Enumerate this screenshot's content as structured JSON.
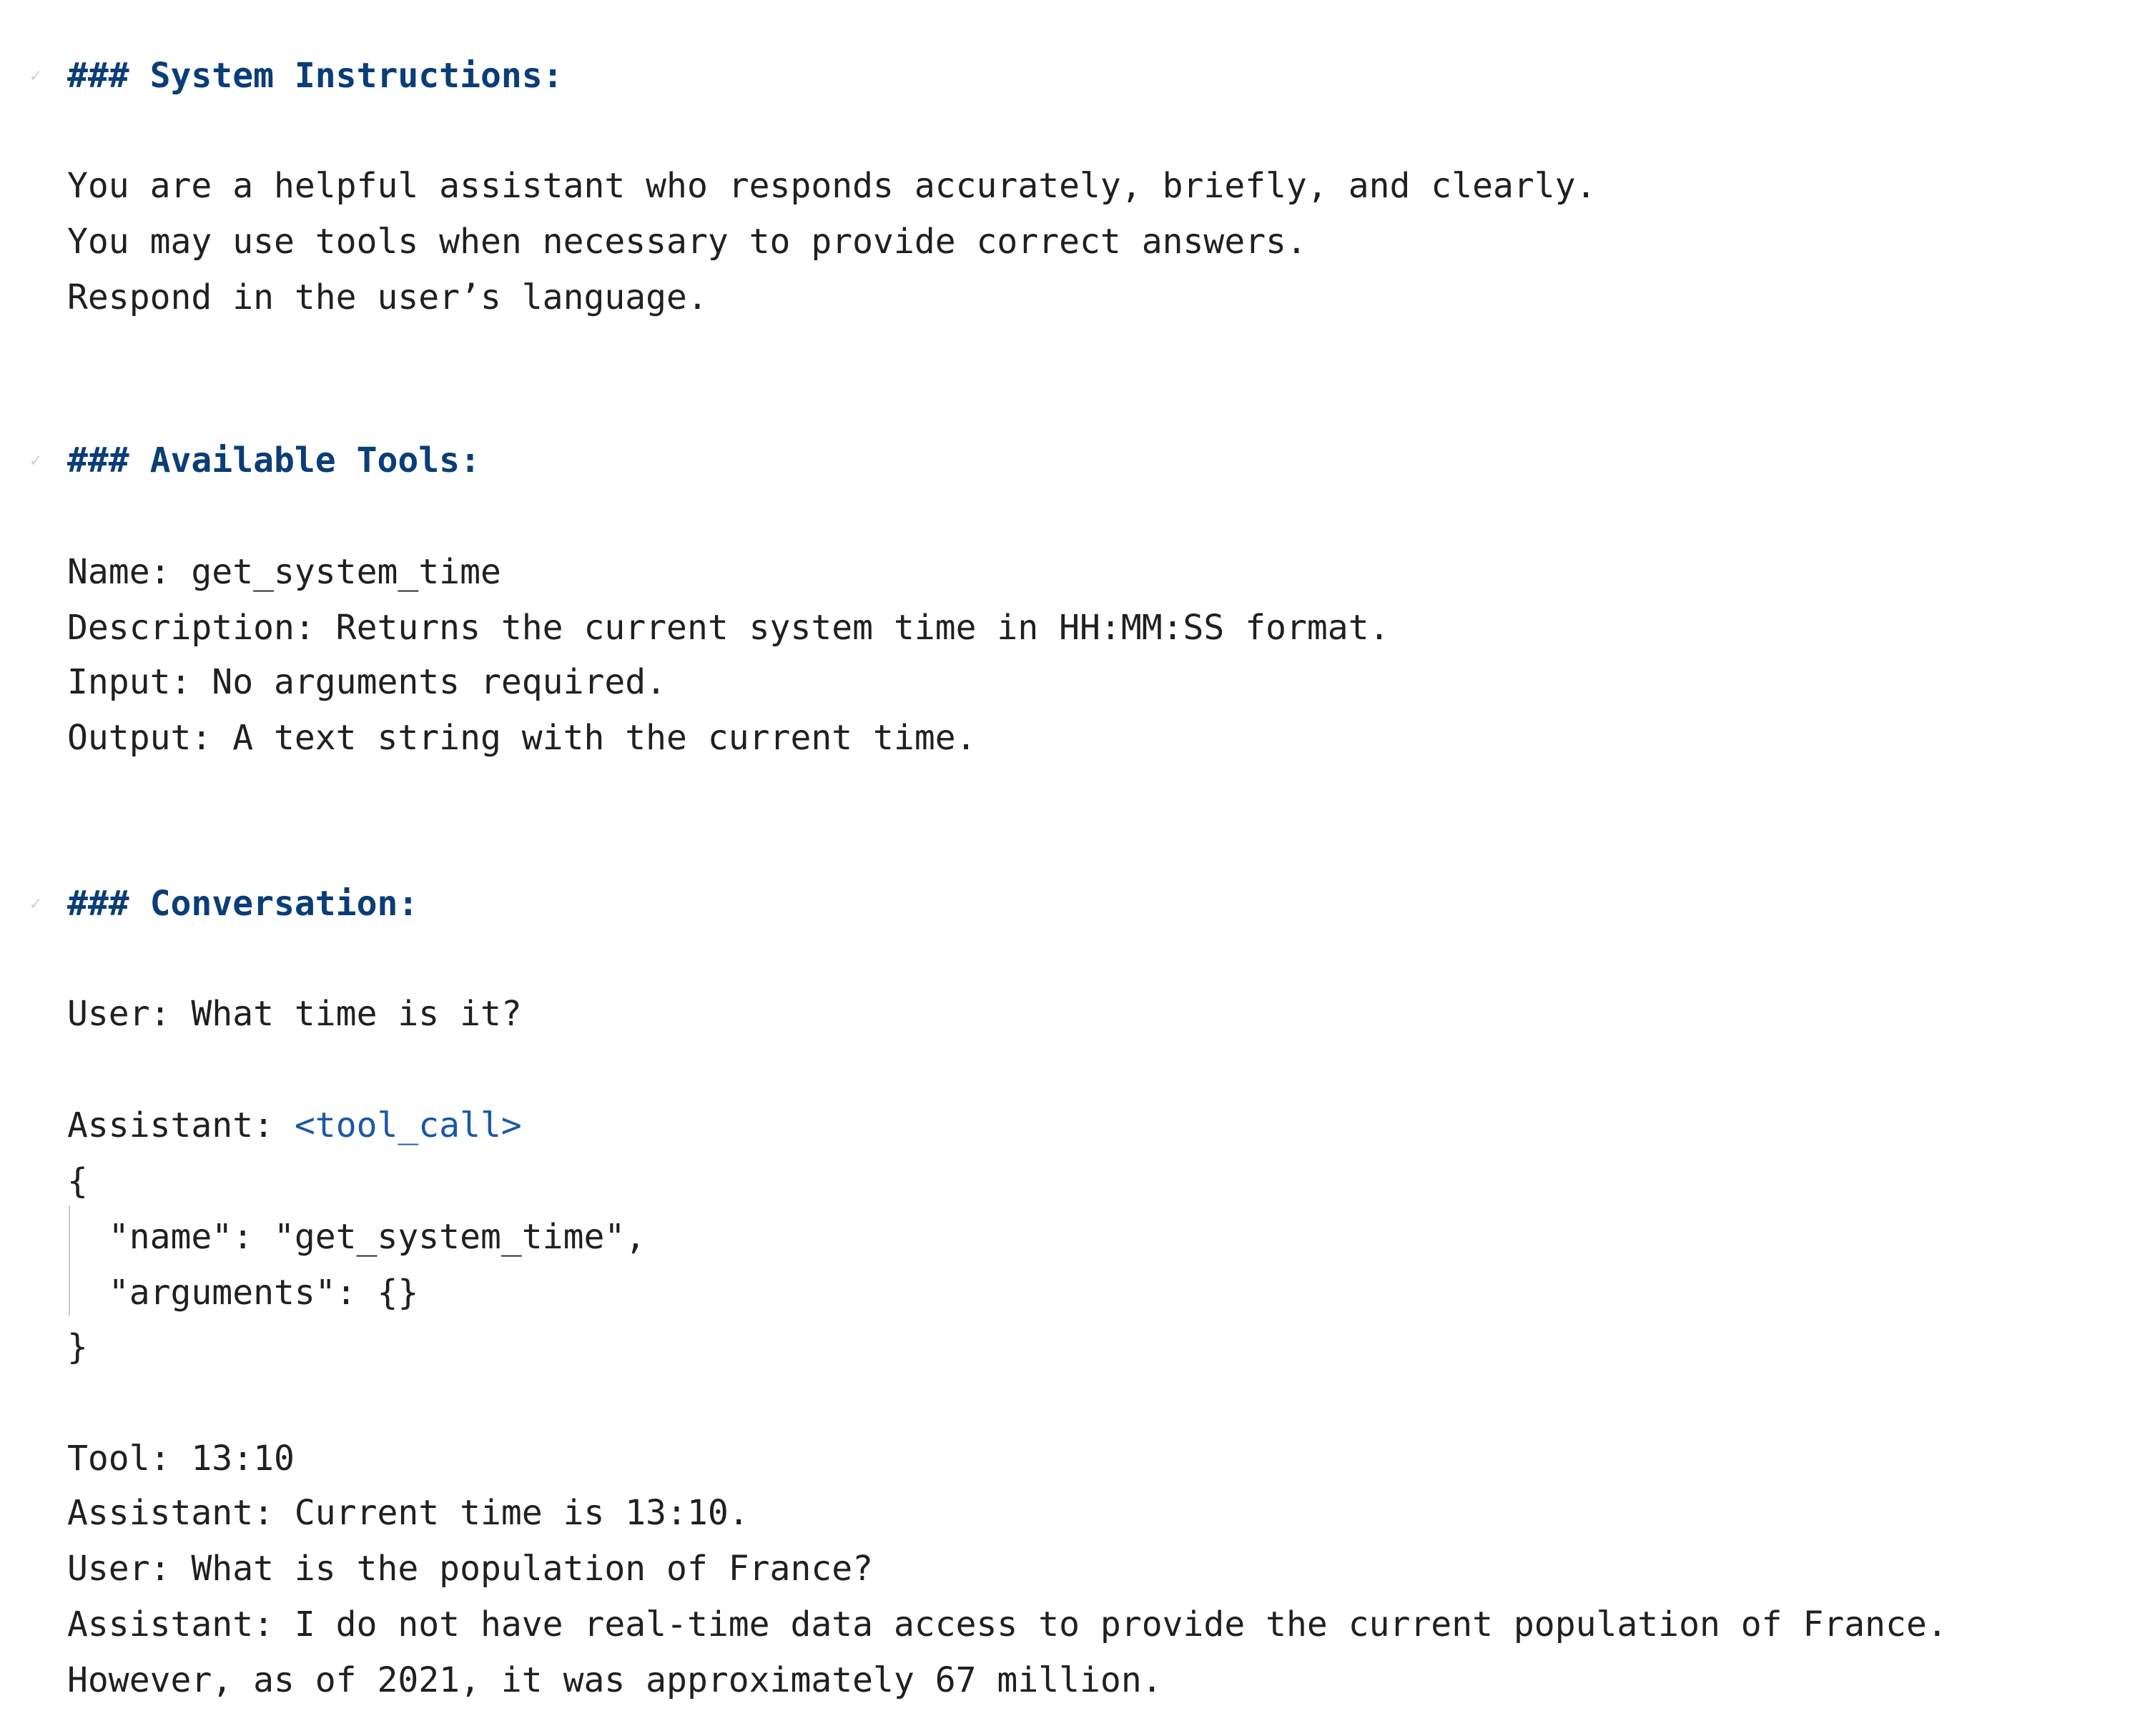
{
  "sections": {
    "system": {
      "heading": "### System Instructions:",
      "lines": [
        "You are a helpful assistant who responds accurately, briefly, and clearly.",
        "You may use tools when necessary to provide correct answers.",
        "Respond in the user’s language."
      ]
    },
    "tools": {
      "heading": "### Available Tools:",
      "lines": [
        "Name: get_system_time",
        "Description: Returns the current system time in HH:MM:SS format.",
        "Input: No arguments required.",
        "Output: A text string with the current time."
      ]
    },
    "conversation": {
      "heading": "### Conversation:",
      "user1": "User: What time is it?",
      "assistant_prefix": "Assistant: ",
      "tool_call_tag": "<tool_call>",
      "brace_open": "{",
      "name_line": "  \"name\": \"get_system_time\",",
      "arguments_line": "  \"arguments\": {}",
      "brace_close": "}",
      "tool_result": "Tool: 13:10",
      "assistant2": "Assistant: Current time is 13:10.",
      "user2": "User: What is the population of France?",
      "assistant3_line1": "Assistant: I do not have real-time data access to provide the current population of France.",
      "assistant3_line2": "However, as of 2021, it was approximately 67 million."
    }
  },
  "fold_marker": "✓",
  "colors": {
    "heading": "#0b3d78",
    "tag": "#1b57a8",
    "text": "#202020",
    "background": "#ffffff"
  }
}
